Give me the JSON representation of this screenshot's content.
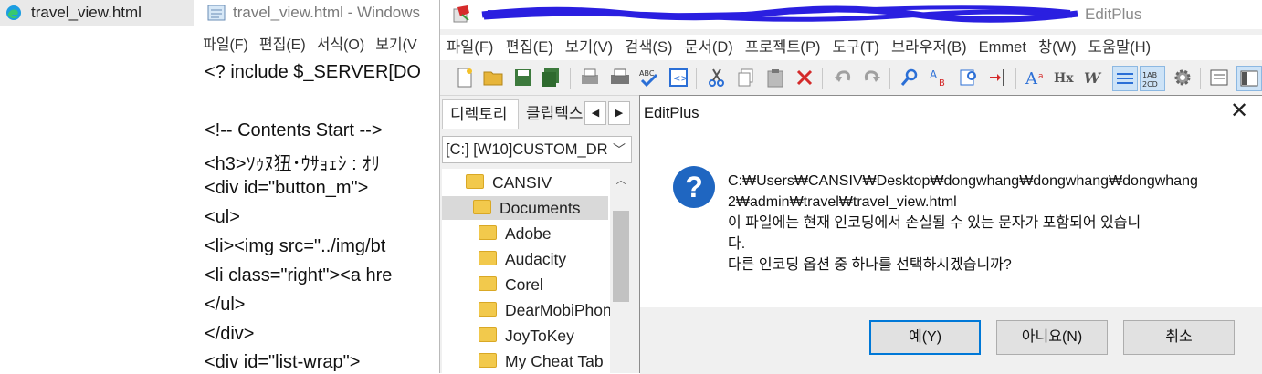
{
  "edge_tab": {
    "title": "travel_view.html"
  },
  "notepad": {
    "title": "travel_view.html - Windows",
    "menu": [
      "파일(F)",
      "편집(E)",
      "서식(O)",
      "보기(V"
    ],
    "lines": [
      "<? include $_SERVER[DO",
      "",
      "<!-- Contents Start -->",
      "<h3>ｿｩﾇ狃･ｳｻｮｪｼ : ｵﾘ",
      "<div id=\"button_m\">",
      "<ul>",
      "<li><img src=\"../img/bt",
      "<li class=\"right\"><a hre",
      "</ul>",
      "</div>",
      "<div id=\"list-wrap\">"
    ]
  },
  "editplus": {
    "title": "EditPlus",
    "menu": [
      "파일(F)",
      "편집(E)",
      "보기(V)",
      "검색(S)",
      "문서(D)",
      "프로젝트(P)",
      "도구(T)",
      "브라우저(B)",
      "Emmet",
      "창(W)",
      "도움말(H)"
    ],
    "toolbar": [
      "new-file",
      "open-folder",
      "save",
      "save-all",
      "print-preview",
      "print",
      "spell-check",
      "browser-preview",
      "cut",
      "copy",
      "paste",
      "delete",
      "undo",
      "redo",
      "find",
      "replace",
      "find-in-files",
      "go-to-line",
      "font-size",
      "hex-view",
      "word-wrap",
      "line-numbers",
      "column-mode",
      "preferences",
      "output-window",
      "directory-window"
    ],
    "panel": {
      "tab_directory": "디렉토리",
      "tab_cliptext": "클립텍스",
      "drive": "[C:] [W10]CUSTOM_DR",
      "tree": [
        "CANSIV",
        "Documents",
        "Adobe",
        "Audacity",
        "Corel",
        "DearMobiPhon",
        "JoyToKey",
        "My Cheat Tab"
      ],
      "selected": "Documents"
    }
  },
  "dialog": {
    "title": "EditPlus",
    "icon": "question-icon",
    "message": [
      "C:₩Users₩CANSIV₩Desktop₩dongwhang₩dongwhang₩dongwhang",
      "2₩admin₩travel₩travel_view.html",
      "이 파일에는 현재 인코딩에서 손실될 수 있는 문자가 포함되어 있습니",
      "다.",
      "다른 인코딩 옵션 중 하나를 선택하시겠습니까?"
    ],
    "buttons": {
      "yes": "예(Y)",
      "no": "아니요(N)",
      "cancel": "취소"
    }
  },
  "colors": {
    "accent": "#0078d7",
    "icon_blue": "#1f66c1",
    "folder": "#f2c94c"
  }
}
